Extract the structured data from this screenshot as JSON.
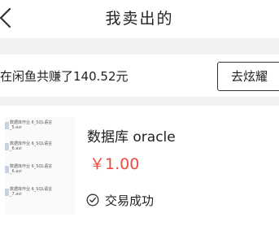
{
  "header": {
    "title": "我卖出的",
    "back_icon": "chevron-left-icon"
  },
  "earnings": {
    "text": "在闲鱼共赚了140.52元",
    "button_label": "去炫耀"
  },
  "order": {
    "title": "数据库 oracle",
    "price": "￥1.00",
    "status": "交易成功",
    "status_icon": "check-circle-icon",
    "price_color": "#ee4a3f",
    "thumbnail_files": [
      "数据库作业 6_SQL语言\n_5.avi",
      "数据库作业 6_SQL语言\n_6.avi",
      "数据库作业 6_SQL语言\n_6.avi",
      "数据库作业 6_SQL语言\n_7.avi"
    ]
  }
}
